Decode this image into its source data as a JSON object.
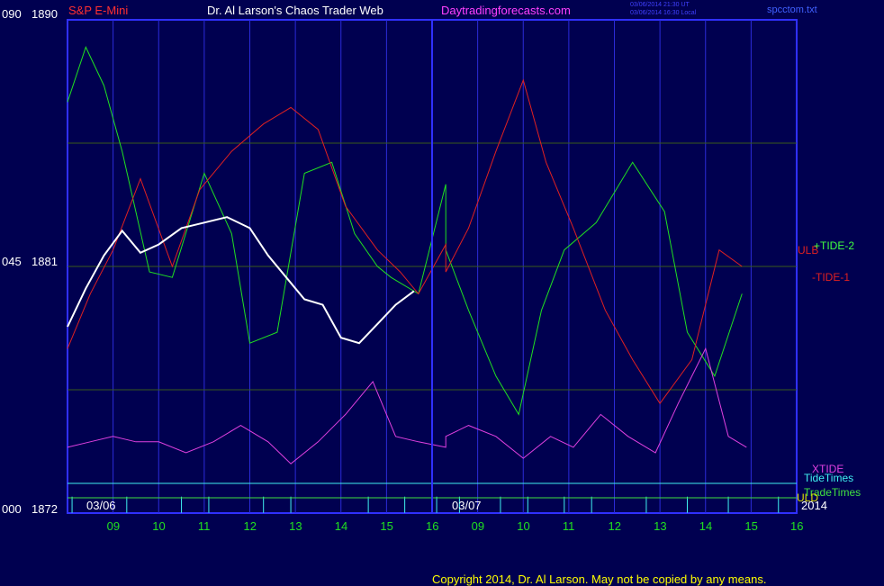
{
  "header": {
    "instrument": "S&P E-Mini",
    "site": "Dr. Al Larson's Chaos Trader Web",
    "url": "Daytradingforecasts.com",
    "stamp_line1": "03/06/2014 21:30 UT",
    "stamp_line2": "03/06/2014 16:30 Local",
    "file": "spcctom.txt"
  },
  "y_axis": {
    "top_label": "090",
    "top_price": "1890",
    "mid_label": "045",
    "mid_price": "1881",
    "bottom_label": "000",
    "bottom_price": "1872"
  },
  "dates": {
    "first": "03/06",
    "second": "03/07",
    "year": "2014"
  },
  "labels": {
    "ulb": "ULB",
    "tide2": "+TIDE-2",
    "tide1": "-TIDE-1",
    "xtide": "XTIDE",
    "tide_times": "TideTimes",
    "trade_times": "TradeTimes",
    "uld": "ULD"
  },
  "copyright": "Copyright 2014, Dr. Al Larson. May not be copied by any means.",
  "colors": {
    "background": "#000050",
    "plot_border": "#3030ff",
    "grid_vertical": "#2b2bd8",
    "grid_horizontal": "#3a5a1a",
    "tide2_green": "#20e020",
    "tide1_red": "#e02020",
    "xtide_magenta": "#e040e0",
    "tide_times_cyan": "#40f0f0",
    "trade_times_green": "#40e040",
    "price_up": "#ffffff",
    "price_down": "#ff1010",
    "yellow": "#ffff40",
    "title_red": "#ff3030",
    "title_white": "#ffffff",
    "title_magenta": "#ff40ff"
  },
  "chart_data": {
    "type": "line",
    "y_range": [
      1872,
      1890
    ],
    "oscillator_range": [
      0,
      90
    ],
    "x_ticks_day1": [
      "09",
      "10",
      "11",
      "12",
      "13",
      "14",
      "15",
      "16"
    ],
    "x_ticks_day2": [
      "09",
      "10",
      "11",
      "12",
      "13",
      "14",
      "15",
      "16"
    ],
    "x_hours": [
      8.1,
      9.3,
      10.5,
      11.1,
      12.3,
      12.9,
      14.6,
      15.4,
      16.1,
      17.1,
      18.0,
      18.6,
      19.4,
      20.0,
      21.2,
      22.1,
      23.0,
      24.1
    ],
    "series": [
      {
        "name": "+TIDE-2",
        "color": "#20e020",
        "points": [
          [
            8.0,
            75
          ],
          [
            8.4,
            85
          ],
          [
            8.8,
            78
          ],
          [
            9.2,
            66
          ],
          [
            9.8,
            44
          ],
          [
            10.3,
            43
          ],
          [
            11.0,
            62
          ],
          [
            11.6,
            51
          ],
          [
            12.0,
            31
          ],
          [
            12.6,
            33
          ],
          [
            13.2,
            62
          ],
          [
            13.8,
            64
          ],
          [
            14.3,
            51
          ],
          [
            14.8,
            45
          ],
          [
            15.1,
            43
          ],
          [
            15.7,
            40
          ],
          [
            16.3,
            60
          ],
          [
            16.8,
            48
          ],
          [
            17.3,
            37
          ],
          [
            17.9,
            25
          ],
          [
            18.4,
            18
          ],
          [
            18.9,
            37
          ],
          [
            19.4,
            48
          ],
          [
            20.1,
            53
          ],
          [
            20.9,
            64
          ],
          [
            21.6,
            55
          ],
          [
            22.1,
            33
          ],
          [
            22.7,
            25
          ],
          [
            23.3,
            40
          ]
        ]
      },
      {
        "name": "-TIDE-1",
        "color": "#e02020",
        "points": [
          [
            8.0,
            30
          ],
          [
            8.5,
            40
          ],
          [
            9.0,
            48
          ],
          [
            9.6,
            61
          ],
          [
            10.3,
            45
          ],
          [
            10.9,
            59
          ],
          [
            11.6,
            66
          ],
          [
            12.3,
            71
          ],
          [
            12.9,
            74
          ],
          [
            13.5,
            70
          ],
          [
            14.1,
            56
          ],
          [
            14.8,
            48
          ],
          [
            15.3,
            44
          ],
          [
            15.7,
            40
          ],
          [
            16.3,
            49
          ],
          [
            16.8,
            44
          ],
          [
            17.3,
            52
          ],
          [
            17.9,
            66
          ],
          [
            18.5,
            79
          ],
          [
            19.0,
            64
          ],
          [
            19.6,
            52
          ],
          [
            20.3,
            37
          ],
          [
            20.9,
            28
          ],
          [
            21.5,
            20
          ],
          [
            22.2,
            28
          ],
          [
            22.8,
            48
          ],
          [
            23.3,
            45
          ]
        ]
      },
      {
        "name": "XTIDE",
        "color": "#e040e0",
        "points": [
          [
            8.0,
            12
          ],
          [
            8.5,
            13
          ],
          [
            9.0,
            14
          ],
          [
            9.5,
            13
          ],
          [
            10.0,
            13
          ],
          [
            10.6,
            11
          ],
          [
            11.2,
            13
          ],
          [
            11.8,
            16
          ],
          [
            12.4,
            13
          ],
          [
            12.9,
            9
          ],
          [
            13.5,
            13
          ],
          [
            14.1,
            18
          ],
          [
            14.7,
            24
          ],
          [
            15.2,
            14
          ],
          [
            15.7,
            13
          ],
          [
            16.3,
            12
          ],
          [
            16.8,
            14
          ],
          [
            17.3,
            16
          ],
          [
            17.9,
            14
          ],
          [
            18.5,
            10
          ],
          [
            19.1,
            14
          ],
          [
            19.6,
            12
          ],
          [
            20.2,
            18
          ],
          [
            20.8,
            14
          ],
          [
            21.4,
            11
          ],
          [
            21.9,
            20
          ],
          [
            22.5,
            30
          ],
          [
            23.0,
            14
          ],
          [
            23.4,
            12
          ]
        ]
      },
      {
        "name": "Close",
        "color": "#ffffff",
        "points": [
          [
            8.0,
            1878.8
          ],
          [
            8.4,
            1880.2
          ],
          [
            8.8,
            1881.4
          ],
          [
            9.2,
            1882.3
          ],
          [
            9.6,
            1881.5
          ],
          [
            10.0,
            1881.8
          ],
          [
            10.5,
            1882.4
          ],
          [
            11.0,
            1882.6
          ],
          [
            11.5,
            1882.8
          ],
          [
            12.0,
            1882.4
          ],
          [
            12.4,
            1881.4
          ],
          [
            12.8,
            1880.6
          ],
          [
            13.2,
            1879.8
          ],
          [
            13.6,
            1879.6
          ],
          [
            14.0,
            1878.4
          ],
          [
            14.4,
            1878.2
          ],
          [
            14.8,
            1878.9
          ],
          [
            15.2,
            1879.6
          ],
          [
            15.6,
            1880.1
          ]
        ]
      }
    ]
  }
}
